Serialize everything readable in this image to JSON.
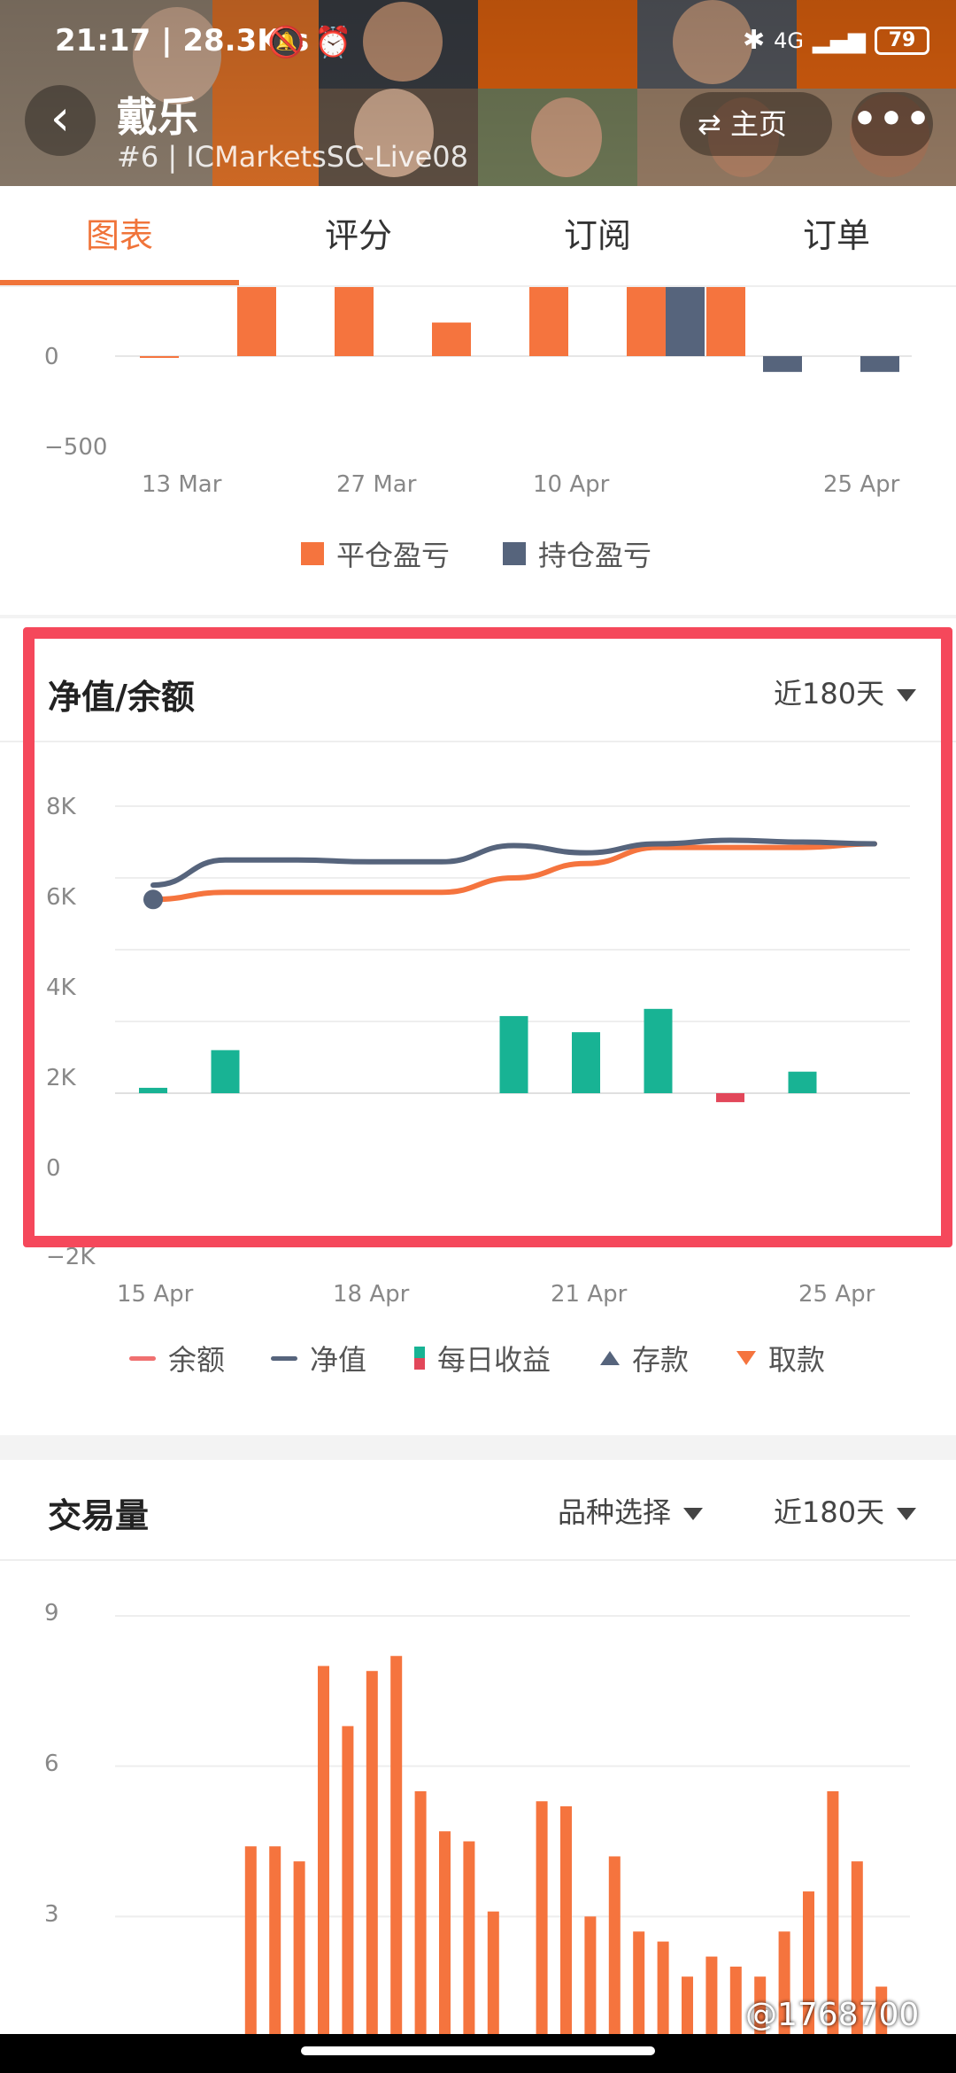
{
  "status": {
    "time": "21:17",
    "speed": "28.3K/s",
    "network": "4G",
    "battery": "79"
  },
  "header": {
    "name": "戴乐",
    "subtitle": "#6 | ICMarketsSC-Live08",
    "home_label": "主页",
    "more_label": "•••",
    "back_icon": "chevron-left-icon"
  },
  "tabs": [
    "图表",
    "评分",
    "订阅",
    "订单"
  ],
  "pnl_chart": {
    "chart_data": {
      "type": "bar",
      "categories": [
        "13 Mar",
        "",
        "",
        "27 Mar",
        "",
        "10 Apr",
        "",
        "",
        "",
        "25 Apr"
      ],
      "yticks": [
        "0",
        "−500"
      ],
      "xticks": [
        "13 Mar",
        "27 Mar",
        "10 Apr",
        "25 Apr"
      ],
      "series": [
        {
          "name": "平仓盈亏",
          "color": "#f5743e",
          "values": [
            -5,
            350,
            350,
            170,
            350,
            350,
            350,
            0,
            0,
            0
          ]
        },
        {
          "name": "持仓盈亏",
          "color": "#56647c",
          "values": [
            0,
            0,
            0,
            0,
            0,
            0,
            350,
            0,
            -80,
            -80
          ]
        }
      ]
    }
  },
  "equity_chart": {
    "title": "净值/余额",
    "period": "近180天",
    "chart_data": {
      "type": "line",
      "yticks": [
        "8K",
        "6K",
        "4K",
        "2K",
        "0",
        "−2K"
      ],
      "xticks": [
        "15 Apr",
        "18 Apr",
        "21 Apr",
        "25 Apr"
      ],
      "ylim": [
        -2000,
        8000
      ],
      "x": [
        0,
        1,
        2,
        3,
        4,
        5,
        6,
        7,
        8,
        9,
        10
      ],
      "series": [
        {
          "name": "余额",
          "color": "#f5743e",
          "values": [
            5400,
            5600,
            5600,
            5600,
            5600,
            6000,
            6400,
            6850,
            6850,
            6850,
            6950
          ]
        },
        {
          "name": "净值",
          "color": "#56647c",
          "values": [
            5800,
            6500,
            6500,
            6450,
            6450,
            6900,
            6700,
            6950,
            7050,
            7000,
            6950
          ]
        },
        {
          "name": "每日收益",
          "color": "#18b394",
          "values": [
            150,
            1200,
            0,
            0,
            0,
            2150,
            1700,
            2350,
            -250,
            600,
            0
          ]
        }
      ],
      "legend": [
        "余额",
        "净值",
        "每日收益",
        "存款",
        "取款"
      ]
    }
  },
  "volume_chart": {
    "title": "交易量",
    "filter_label": "品种选择",
    "period": "近180天",
    "chart_data": {
      "type": "bar",
      "yticks": [
        "9",
        "6",
        "3"
      ],
      "ylim": [
        0,
        9
      ],
      "values": [
        0.6,
        0.0,
        4.4,
        4.4,
        4.1,
        8.0,
        6.8,
        7.9,
        8.2,
        5.5,
        4.7,
        4.5,
        3.1,
        0,
        5.3,
        5.2,
        3.0,
        4.2,
        2.7,
        2.5,
        1.8,
        2.2,
        2.0,
        1.8,
        2.7,
        3.5,
        5.5,
        4.1,
        1.6
      ],
      "color": "#f5743e"
    }
  },
  "watermark": "@1768700"
}
